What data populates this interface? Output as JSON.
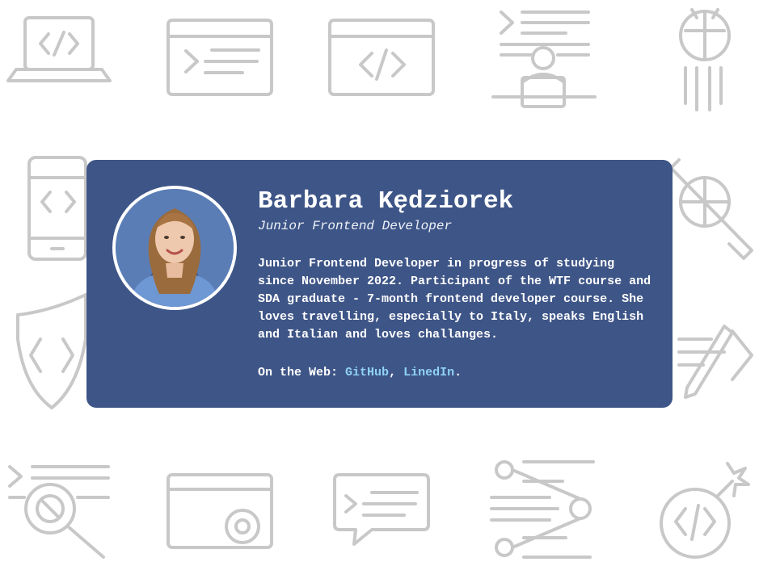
{
  "profile": {
    "name": "Barbara Kędziorek",
    "role": "Junior Frontend Developer",
    "bio": "Junior Frontend Developer in progress of studying since November 2022. Participant of the WTF course and SDA graduate - 7-month frontend developer course. She loves travelling, especially to Italy, speaks English and Italian and loves challanges.",
    "web_label": "On the Web:",
    "links": [
      {
        "label": "GitHub"
      },
      {
        "label": "LinedIn"
      }
    ],
    "separator": ",",
    "terminator": "."
  },
  "colors": {
    "card": "#3e5587",
    "link": "#8fd3f4",
    "icons": "#c8c8c8"
  },
  "background_icons": [
    "laptop-code-icon",
    "terminal-window-icon",
    "browser-code-icon",
    "developer-at-desk-icon",
    "bug-icon",
    "phone-code-icon",
    "bug-wrench-icon",
    "shield-code-icon",
    "pencil-code-icon",
    "bug-search-icon",
    "browser-settings-icon",
    "chat-terminal-icon",
    "code-flow-icon",
    "code-bomb-icon"
  ]
}
